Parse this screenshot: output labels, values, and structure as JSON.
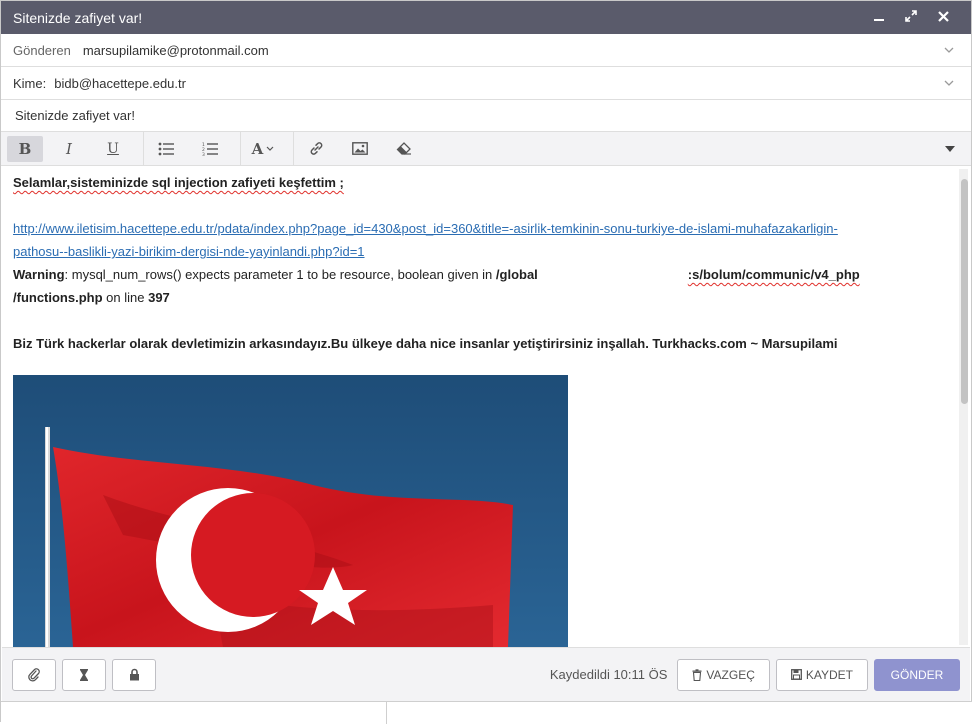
{
  "window": {
    "title": "Sitenizde zafiyet var!",
    "minimize_icon": "minimize-icon",
    "restore_icon": "restore-icon",
    "close_icon": "close-icon"
  },
  "from": {
    "label": "Gönderen",
    "value": "marsupilamike@protonmail.com"
  },
  "to": {
    "label": "Kime:",
    "value": "bidb@hacettepe.edu.tr"
  },
  "subject": "Sitenizde zafiyet var!",
  "toolbar": {
    "bold": "B",
    "italic": "I",
    "underline": "U",
    "font": "A"
  },
  "body": {
    "line1": "Selamlar,sisteminizde sql injection zafiyeti keşfettim ;",
    "link_line1": "http://www.iletisim.hacettepe.edu.tr/pdata/index.php?page_id=430&post_id=360&title=-asirlik-temkinin-sonu-turkiye-de-islami-muhafazakarligin-",
    "link_line2": "pathosu--baslikli-yazi-birikim-dergisi-nde-yayinlandi.php?id=1",
    "warning_label": "Warning",
    "warning_text": ": mysql_num_rows() expects parameter 1 to be resource, boolean given in ",
    "warning_path1": "/global",
    "warning_path2": ":s/bolum/communic/v4_php",
    "warning_path3": "/functions.php",
    "warning_online": " on line ",
    "warning_line": "397",
    "closing": "Biz Türk hackerlar olarak devletimizin arkasındayız.Bu ülkeye daha nice insanlar yetiştirirsiniz inşallah. Turkhacks.com ~ Marsupilami"
  },
  "footer": {
    "saved": "Kaydedildi 10:11 ÖS",
    "cancel": "VAZGEÇ",
    "save": "KAYDET",
    "send": "GÖNDER"
  },
  "colors": {
    "titlebar": "#5a5b6b",
    "send_button": "#8f93cf",
    "link": "#2b6db3"
  }
}
